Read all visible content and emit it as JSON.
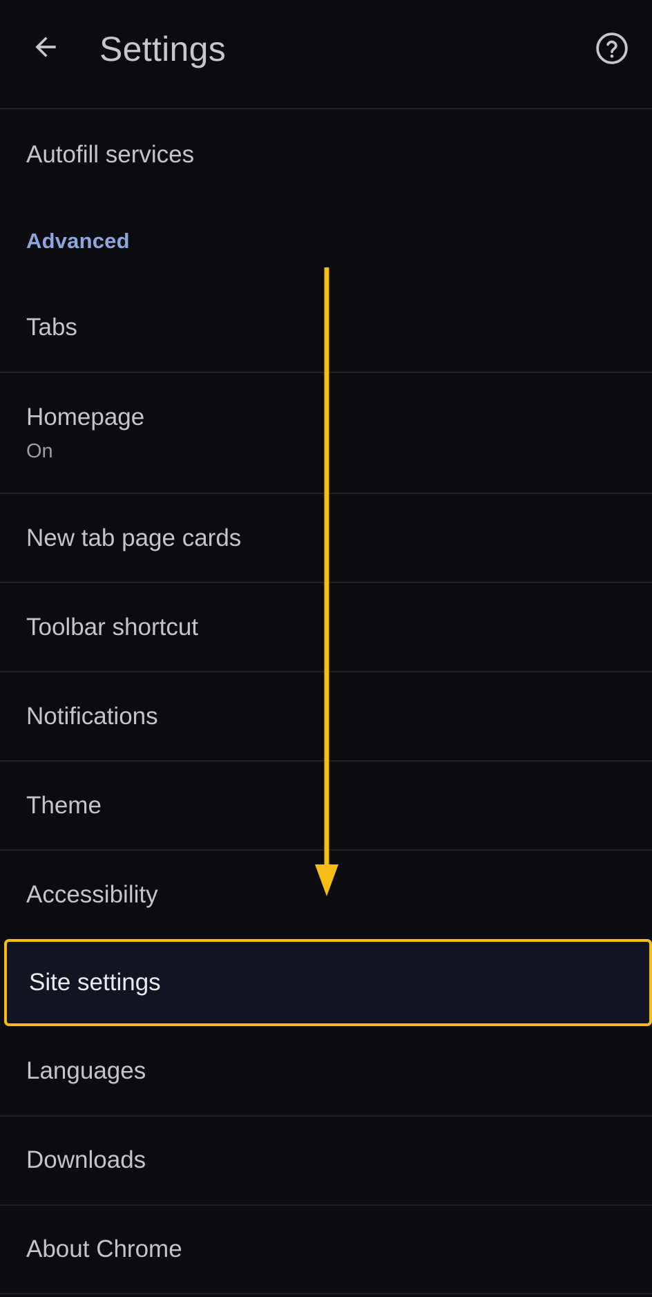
{
  "header": {
    "title": "Settings",
    "back_icon": "arrow-left-icon",
    "help_icon": "help-circle-icon"
  },
  "items_top": [
    {
      "label": "Autofill services"
    }
  ],
  "section": {
    "label": "Advanced",
    "color": "#8ea6dc"
  },
  "items": [
    {
      "label": "Tabs"
    },
    {
      "label": "Homepage",
      "sub": "On"
    },
    {
      "label": "New tab page cards"
    },
    {
      "label": "Toolbar shortcut"
    },
    {
      "label": "Notifications"
    },
    {
      "label": "Theme"
    },
    {
      "label": "Accessibility"
    },
    {
      "label": "Site settings",
      "highlighted": true
    },
    {
      "label": "Languages"
    },
    {
      "label": "Downloads"
    },
    {
      "label": "About Chrome"
    }
  ],
  "annotation": {
    "type": "scroll-down-arrow",
    "color": "#f6bd16"
  }
}
